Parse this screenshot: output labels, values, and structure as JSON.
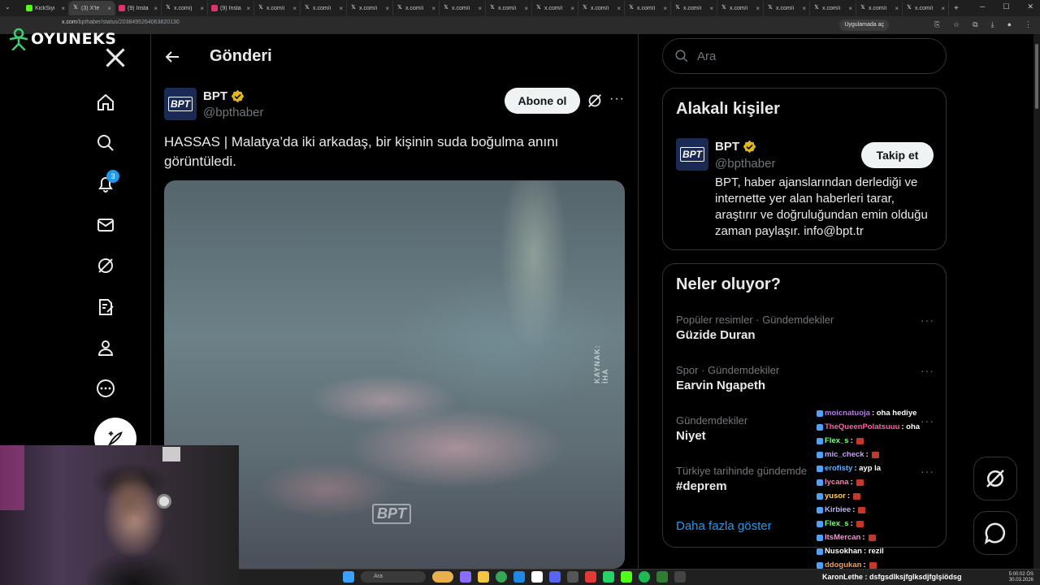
{
  "browser": {
    "tabs": [
      {
        "label": "KickSiyi",
        "color": "#53fc18",
        "active": false
      },
      {
        "label": "(3) X'te",
        "color": "#ffffff",
        "active": true
      },
      {
        "label": "(9) Insta",
        "color": "#e1306c",
        "active": false
      },
      {
        "label": "x.com/j",
        "color": "#ffffff",
        "active": false
      },
      {
        "label": "(9) Insta",
        "color": "#e1306c",
        "active": false
      },
      {
        "label": "x.com/i",
        "color": "#ffffff",
        "active": false
      },
      {
        "label": "x.com/i",
        "color": "#ffffff",
        "active": false
      },
      {
        "label": "x.com/i",
        "color": "#ffffff",
        "active": false
      },
      {
        "label": "x.com/i",
        "color": "#ffffff",
        "active": false
      },
      {
        "label": "x.com/i",
        "color": "#ffffff",
        "active": false
      },
      {
        "label": "x.com/i",
        "color": "#ffffff",
        "active": false
      },
      {
        "label": "x.com/i",
        "color": "#ffffff",
        "active": false
      },
      {
        "label": "x.com/i",
        "color": "#ffffff",
        "active": false
      },
      {
        "label": "x.com/i",
        "color": "#ffffff",
        "active": false
      },
      {
        "label": "x.com/i",
        "color": "#ffffff",
        "active": false
      },
      {
        "label": "x.com/i",
        "color": "#ffffff",
        "active": false
      },
      {
        "label": "x.com/i",
        "color": "#ffffff",
        "active": false
      },
      {
        "label": "x.com/i",
        "color": "#ffffff",
        "active": false
      },
      {
        "label": "x.com/i",
        "color": "#ffffff",
        "active": false
      },
      {
        "label": "x.com/i",
        "color": "#ffffff",
        "active": false
      }
    ],
    "url_host": "x.com",
    "url_path": "/bpthaber/status/2038495264063820130",
    "app_button": "Uygulamada aç"
  },
  "overlay": {
    "logo_text": "OYUNEKS"
  },
  "nav": {
    "notification_count": "3"
  },
  "header": {
    "title": "Gönderi"
  },
  "tweet": {
    "name": "BPT",
    "handle": "@bpthaber",
    "subscribe_label": "Abone ol",
    "text": "HASSAS | Malatya’da iki arkadaş, bir kişinin suda boğulma anını görüntüledi.",
    "avatar_text": "BPT",
    "media_source": "KAYNAK: İHA",
    "media_watermark": "BPT"
  },
  "search": {
    "placeholder": "Ara"
  },
  "related": {
    "title": "Alakalı kişiler",
    "name": "BPT",
    "handle": "@bpthaber",
    "follow_label": "Takip et",
    "bio": "BPT, haber ajanslarından derlediği ve internette yer alan haberleri tarar, araştırır ve doğruluğundan emin olduğu zaman paylaşır. info@bpt.tr"
  },
  "trends": {
    "title": "Neler oluyor?",
    "items": [
      {
        "context": "Popüler resimler · Gündemdekiler",
        "name": "Güzide Duran"
      },
      {
        "context": "Spor · Gündemdekiler",
        "name": "Earvin Ngapeth"
      },
      {
        "context": "Gündemdekiler",
        "name": "Niyet"
      },
      {
        "context": "Türkiye tarihinde gündemde",
        "name": "#deprem"
      }
    ],
    "show_more": "Daha fazla göster"
  },
  "chat": {
    "lines": [
      {
        "user": "moicnatuoja",
        "msg": ": oha hediye",
        "color": "#b57edc"
      },
      {
        "user": "TheQueenPolatsuuu",
        "msg": ": oha",
        "color": "#ff5fa2"
      },
      {
        "user": "Flex_s",
        "msg": ":",
        "color": "#7dff7d",
        "emote": true
      },
      {
        "user": "mic_check",
        "msg": ":",
        "color": "#c9a0ff",
        "emote": true
      },
      {
        "user": "erofisty",
        "msg": ": ayp la",
        "color": "#5fb0ff"
      },
      {
        "user": "lycana",
        "msg": ":",
        "color": "#ff7aa8",
        "emote": true
      },
      {
        "user": "yusor",
        "msg": ":",
        "color": "#ffd15f",
        "emote": true
      },
      {
        "user": "Kirbiee",
        "msg": ":",
        "color": "#b0b0ff",
        "emote": true
      },
      {
        "user": "Flex_s",
        "msg": ":",
        "color": "#7dff7d",
        "emote": true
      },
      {
        "user": "ItsMercan",
        "msg": ":",
        "color": "#ff8cd6",
        "emote": true
      },
      {
        "user": "Nusokhan",
        "msg": ": rezil",
        "color": "#ffffff"
      },
      {
        "user": "ddogukan",
        "msg": ":",
        "color": "#ff9f40",
        "emote": true
      }
    ],
    "bottom_line": "KaronLethe : dsfgsdlksjfglksdjfglşiödsg"
  },
  "taskbar": {
    "search_label": "Ara",
    "time": "5:00:02 ÖS",
    "date": "30.03.2026"
  },
  "colors": {
    "accent": "#1d9bf0",
    "verified": "#e2b719",
    "bg": "#000000",
    "border": "#2f3336"
  }
}
